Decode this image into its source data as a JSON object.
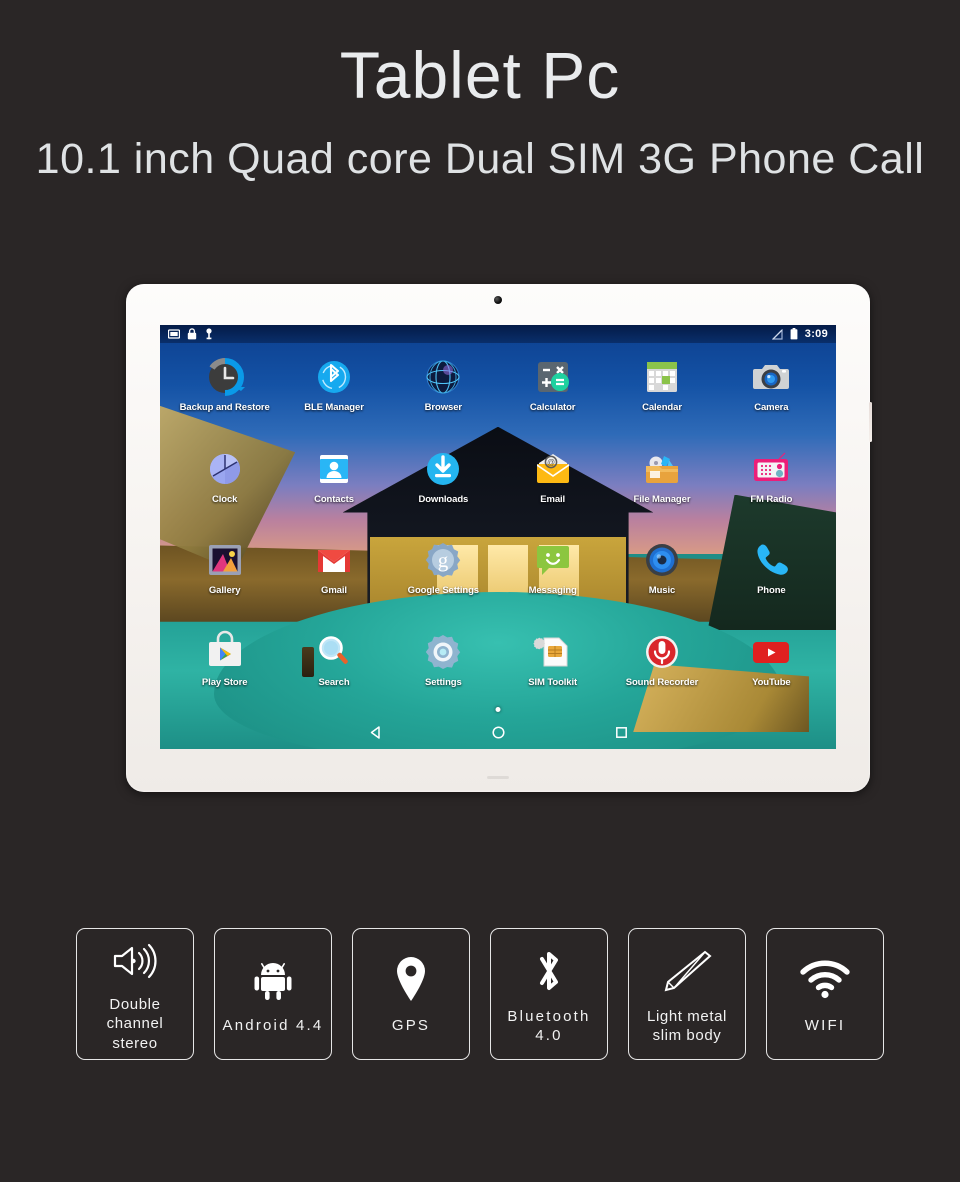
{
  "header": {
    "title": "Tablet Pc",
    "subtitle": "10.1 inch Quad core Dual SIM 3G Phone Call"
  },
  "tablet": {
    "camera_icon": "front-camera",
    "status_bar": {
      "left_icons": [
        "screenshot-icon",
        "lock-icon",
        "usb-icon"
      ],
      "right_icons": [
        "signal-off-icon",
        "battery-icon"
      ],
      "time": "3:09"
    },
    "apps": [
      {
        "label": "Backup and Restore",
        "icon": "backup-and-restore-icon"
      },
      {
        "label": "BLE Manager",
        "icon": "ble-manager-icon"
      },
      {
        "label": "Browser",
        "icon": "browser-icon"
      },
      {
        "label": "Calculator",
        "icon": "calculator-icon"
      },
      {
        "label": "Calendar",
        "icon": "calendar-icon"
      },
      {
        "label": "Camera",
        "icon": "camera-icon"
      },
      {
        "label": "Clock",
        "icon": "clock-icon"
      },
      {
        "label": "Contacts",
        "icon": "contacts-icon"
      },
      {
        "label": "Downloads",
        "icon": "downloads-icon"
      },
      {
        "label": "Email",
        "icon": "email-icon"
      },
      {
        "label": "File Manager",
        "icon": "file-manager-icon"
      },
      {
        "label": "FM Radio",
        "icon": "fm-radio-icon"
      },
      {
        "label": "Gallery",
        "icon": "gallery-icon"
      },
      {
        "label": "Gmail",
        "icon": "gmail-icon"
      },
      {
        "label": "Google Settings",
        "icon": "google-settings-icon"
      },
      {
        "label": "Messaging",
        "icon": "messaging-icon"
      },
      {
        "label": "Music",
        "icon": "music-icon"
      },
      {
        "label": "Phone",
        "icon": "phone-icon"
      },
      {
        "label": "Play Store",
        "icon": "play-store-icon"
      },
      {
        "label": "Search",
        "icon": "search-icon"
      },
      {
        "label": "Settings",
        "icon": "settings-icon"
      },
      {
        "label": "SIM Toolkit",
        "icon": "sim-toolkit-icon"
      },
      {
        "label": "Sound Recorder",
        "icon": "sound-recorder-icon"
      },
      {
        "label": "YouTube",
        "icon": "youtube-icon"
      }
    ],
    "nav_bar": {
      "back": "back-icon",
      "home": "home-icon",
      "recents": "recents-icon",
      "page_indicator": "page-dot"
    }
  },
  "features": [
    {
      "label": "Double channel\nstereo",
      "icon": "speaker-icon",
      "spaced": false
    },
    {
      "label": "Android 4.4",
      "icon": "android-icon",
      "spaced": true
    },
    {
      "label": "GPS",
      "icon": "location-pin-icon",
      "spaced": true
    },
    {
      "label": "Bluetooth\n4.0",
      "icon": "bluetooth-icon",
      "spaced": true
    },
    {
      "label": "Light metal\nslim body",
      "icon": "slim-body-icon",
      "spaced": false
    },
    {
      "label": "WIFI",
      "icon": "wifi-icon",
      "spaced": true
    }
  ],
  "colors": {
    "background": "#2a2626",
    "text": "#e8eaec",
    "tablet_frame": "#fdfcfb",
    "status_bar": "#031438"
  }
}
